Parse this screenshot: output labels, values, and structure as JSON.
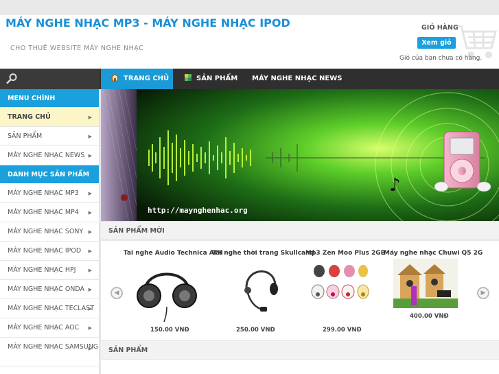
{
  "header": {
    "title": "MÁY NGHE NHẠC MP3 - MÁY NGHE NHẠC IPOD",
    "slogan": "CHO THUÊ WEBSITE MÁY NGHE NHẠC"
  },
  "cart": {
    "title": "GIỎ HÀNG",
    "view_label": "Xem giỏ",
    "empty_text": "Giỏ của bạn chưa có hàng."
  },
  "nav": {
    "home": "TRANG CHỦ",
    "products": "SẢN PHẨM",
    "news": "MÁY NGHE NHẠC NEWS"
  },
  "sidebar": {
    "main_menu_title": "MENU CHÍNH",
    "main_items": [
      {
        "label": "TRANG CHỦ"
      },
      {
        "label": "SẢN PHẨM"
      },
      {
        "label": "MÁY NGHE NHẠC NEWS"
      }
    ],
    "category_title": "DANH MỤC SẢN PHẨM",
    "category_items": [
      {
        "label": "MÁY NGHE NHẠC MP3"
      },
      {
        "label": "MÁY NGHE NHẠC MP4"
      },
      {
        "label": "MÁY NGHE NHẠC SONY"
      },
      {
        "label": "MÁY NGHE NHẠC IPOD"
      },
      {
        "label": "MÁY NGHE NHẠC HPJ"
      },
      {
        "label": "MÁY NGHE NHẠC ONDA"
      },
      {
        "label": "MÁY NGHE NHẠC TECLAST"
      },
      {
        "label": "MÁY NGHE NHẠC AOC"
      },
      {
        "label": "MÁY NGHE NHẠC SAMSUNG"
      }
    ]
  },
  "banner": {
    "url_text": "http://maynghenhac.org"
  },
  "sections": {
    "new_products": "SẢN PHẨM MỚI",
    "products": "SẢN PHẨM"
  },
  "products": [
    {
      "name": "Tai nghe Audio Technica ATH",
      "price": "150.00 VNĐ"
    },
    {
      "name": "Tai nghe thời trang Skullcand",
      "price": "250.00 VNĐ"
    },
    {
      "name": "Mp3 Zen Moo Plus 2GB",
      "price": "299.00 VNĐ"
    },
    {
      "name": "Máy nghe nhạc Chuwi Q5 2G",
      "price": "400.00 VNĐ"
    }
  ]
}
